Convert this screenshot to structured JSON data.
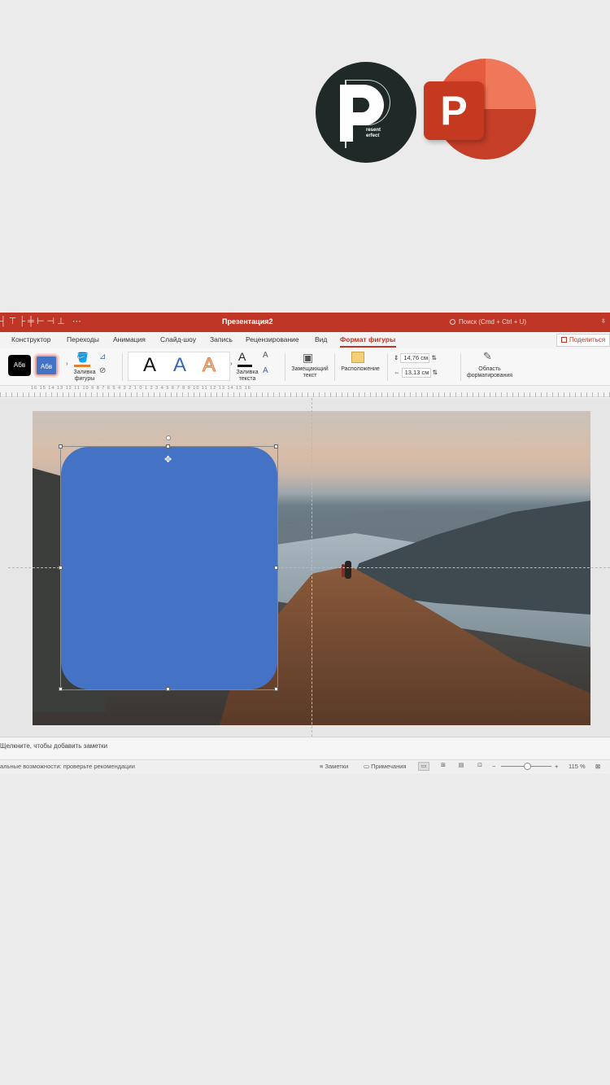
{
  "window": {
    "title": "Презентация2",
    "search_placeholder": "Поиск (Cmd + Ctrl + U)"
  },
  "tabs": [
    {
      "label": "Конструктор"
    },
    {
      "label": "Переходы"
    },
    {
      "label": "Анимация"
    },
    {
      "label": "Слайд-шоу"
    },
    {
      "label": "Запись"
    },
    {
      "label": "Рецензирование"
    },
    {
      "label": "Вид"
    },
    {
      "label": "Формат фигуры"
    }
  ],
  "share_label": "Поделиться",
  "ribbon": {
    "style_dark": "Абв",
    "style_blue": "Абв",
    "shape_fill": "Заливка фигуры",
    "wordart": [
      "A",
      "A",
      "A"
    ],
    "text_fill": "Заливка текста",
    "alt_text": "Замещающий текст",
    "arrange": "Расположение",
    "height": "14,76 см",
    "width": "13,13 см",
    "format_pane": "Область форматирования"
  },
  "ruler_numbers": "16  15  14  13  12  11  10  9  8  7  6  5  4  3  2  1  0  1  2  3  4  5  6  7  8  9  10  11  12  13  14  15  16",
  "notes_placeholder": "Щелкните, чтобы добавить заметки",
  "status": {
    "accessibility": "альные возможности: проверьте рекомендации",
    "notes": "Заметки",
    "comments": "Примечания",
    "zoom": "115 %"
  },
  "colors": {
    "accent": "#bf3627",
    "shape_fill": "#4472c4"
  }
}
